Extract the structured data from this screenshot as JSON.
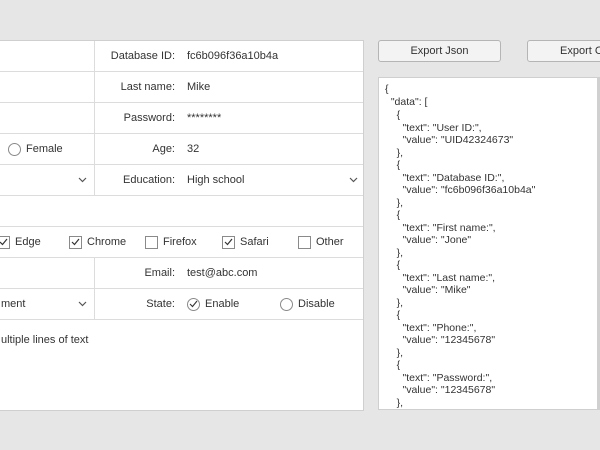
{
  "form": {
    "database_id": {
      "label": "Database ID:",
      "value": "fc6b096f36a10b4a"
    },
    "last_name": {
      "label": "Last name:",
      "value": "Mike"
    },
    "password": {
      "label": "Password:",
      "value": "********"
    },
    "gender": {
      "option_female": "Female"
    },
    "age": {
      "label": "Age:",
      "value": "32"
    },
    "education": {
      "label": "Education:",
      "value": "High school"
    },
    "browsers": [
      {
        "label": "Edge",
        "checked": true
      },
      {
        "label": "Chrome",
        "checked": true
      },
      {
        "label": "Firefox",
        "checked": false
      },
      {
        "label": "Safari",
        "checked": true
      },
      {
        "label": "Other",
        "checked": false
      }
    ],
    "email": {
      "label": "Email:",
      "value": "test@abc.com"
    },
    "department": {
      "value_partial": "ment"
    },
    "state": {
      "label": "State:",
      "option_enable": "Enable",
      "option_disable": "Disable",
      "selected": "Enable"
    },
    "notes": {
      "value_partial": "ultiple lines of text"
    }
  },
  "toolbar": {
    "export_json_label": "Export Json",
    "export_other_label": "Export C"
  },
  "json_view": {
    "lines": [
      "{",
      "  \"data\": [",
      "    {",
      "      \"text\": \"User ID:\",",
      "      \"value\": \"UID42324673\"",
      "    },",
      "    {",
      "      \"text\": \"Database ID:\",",
      "      \"value\": \"fc6b096f36a10b4a\"",
      "    },",
      "    {",
      "      \"text\": \"First name:\",",
      "      \"value\": \"Jone\"",
      "    },",
      "    {",
      "      \"text\": \"Last name:\",",
      "      \"value\": \"Mike\"",
      "    },",
      "    {",
      "      \"text\": \"Phone:\",",
      "      \"value\": \"12345678\"",
      "    },",
      "    {",
      "      \"text\": \"Password:\",",
      "      \"value\": \"12345678\"",
      "    },"
    ]
  }
}
